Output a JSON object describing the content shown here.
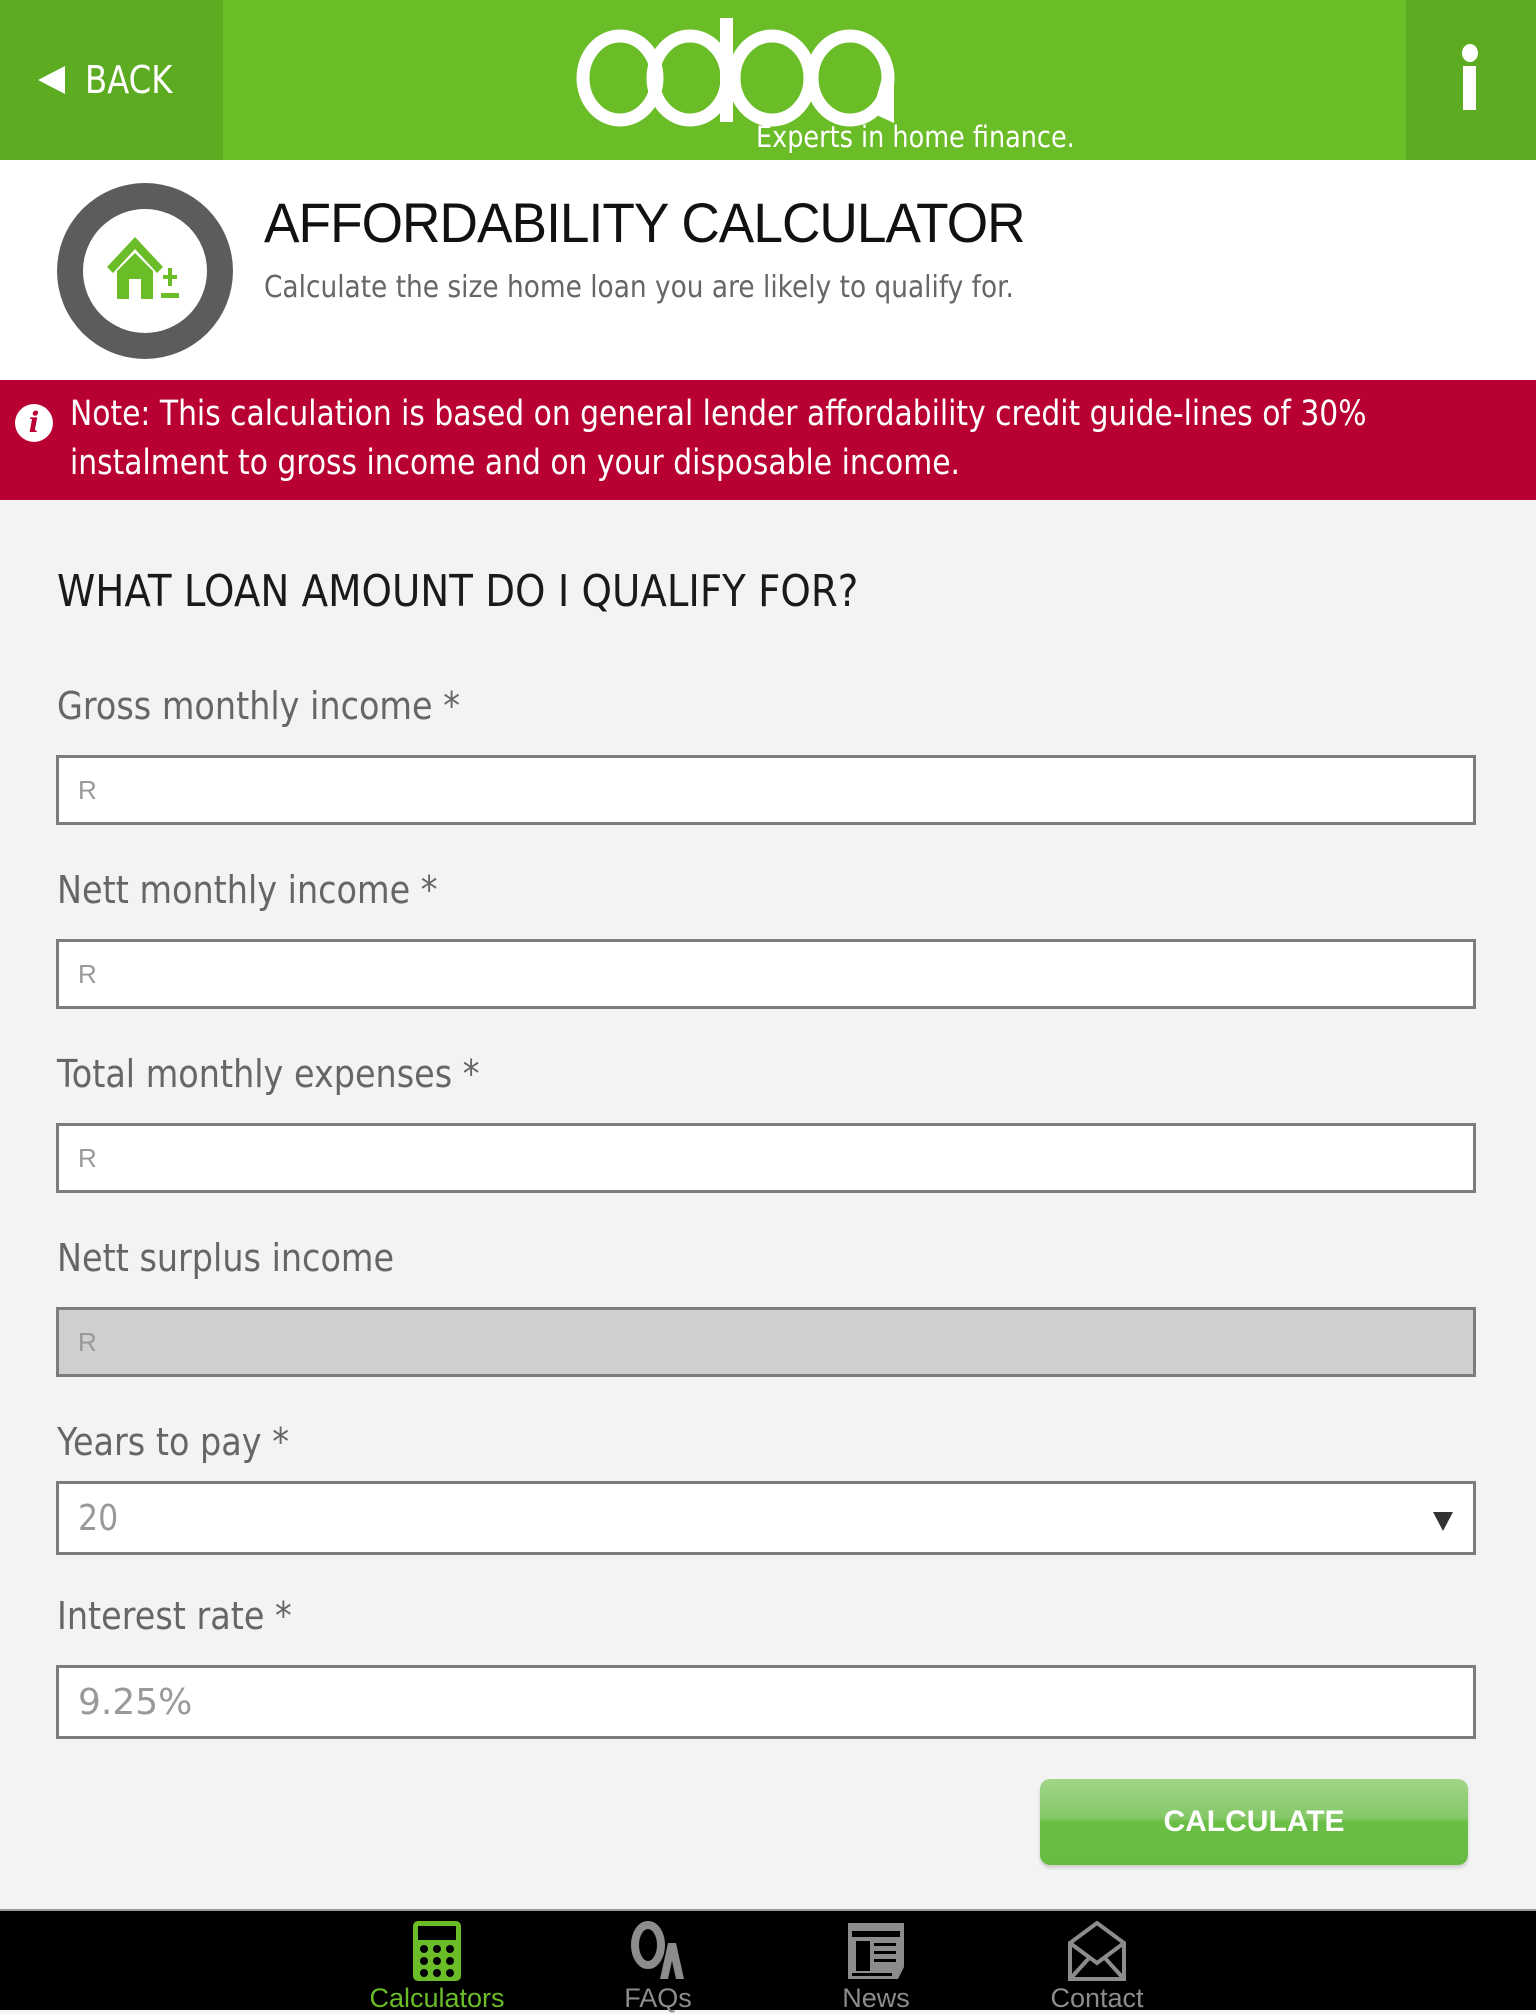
{
  "topbar": {
    "back_label": "BACK",
    "logo_text": "ooba",
    "tagline": "Experts in home finance.",
    "brand_color": "#6bbd28"
  },
  "header": {
    "title": "AFFORDABILITY CALCULATOR",
    "subtitle": "Calculate the size home loan you are likely to qualify for."
  },
  "note": {
    "text": "Note: This calculation is based on general lender affordability credit guide-lines of 30% instalment to gross income and on your disposable income.",
    "color": "#b90032"
  },
  "form": {
    "section_title": "WHAT LOAN AMOUNT DO I QUALIFY FOR?",
    "fields": [
      {
        "label": "Gross monthly income *",
        "placeholder": "R",
        "value": ""
      },
      {
        "label": "Nett monthly income *",
        "placeholder": "R",
        "value": ""
      },
      {
        "label": "Total monthly expenses *",
        "placeholder": "R",
        "value": ""
      },
      {
        "label": "Nett surplus income",
        "placeholder": "R",
        "value": "",
        "disabled": true
      }
    ],
    "years": {
      "label": "Years to pay *",
      "value": "20"
    },
    "rate": {
      "label": "Interest rate *",
      "placeholder": "9.25%"
    },
    "calculate_label": "CALCULATE"
  },
  "tabbar": {
    "tabs": [
      {
        "label": "Calculators",
        "icon": "calculator-icon",
        "active": true
      },
      {
        "label": "FAQs",
        "icon": "qa-icon",
        "active": false
      },
      {
        "label": "News",
        "icon": "newspaper-icon",
        "active": false
      },
      {
        "label": "Contact",
        "icon": "envelope-icon",
        "active": false
      }
    ]
  }
}
